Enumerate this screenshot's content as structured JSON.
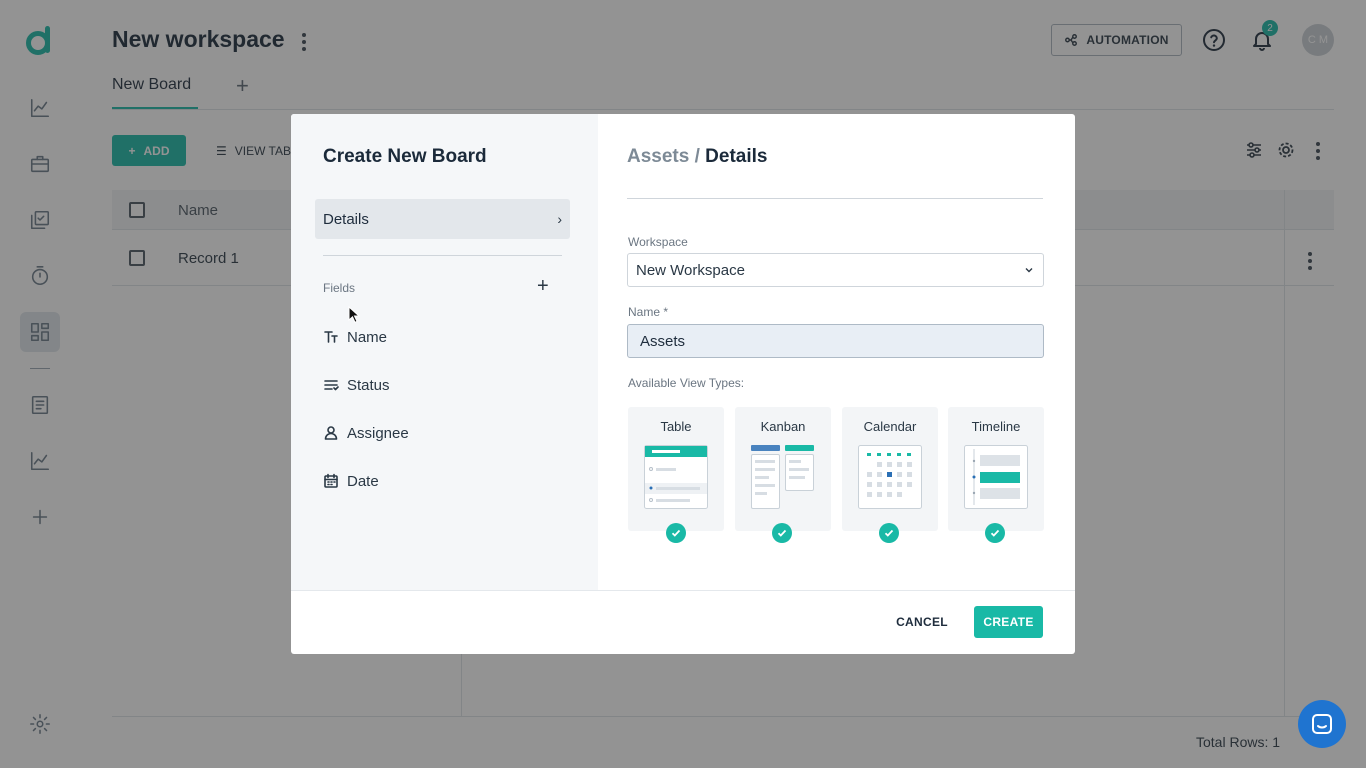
{
  "header": {
    "workspace_title": "New workspace",
    "automation_label": "AUTOMATION",
    "notification_count": "2",
    "avatar_initials": "C M"
  },
  "tabs": [
    {
      "label": "New Board",
      "active": true
    }
  ],
  "toolbar": {
    "add_label": "ADD",
    "view_label": "VIEW TAB"
  },
  "grid": {
    "columns": [
      "Name"
    ],
    "rows": [
      {
        "name": "Record 1"
      }
    ],
    "total_rows": "Total Rows: 1"
  },
  "sidebar": {
    "icons": [
      "analytics-icon",
      "briefcase-icon",
      "tasks-icon",
      "timer-icon",
      "boards-icon",
      "document-icon",
      "reports-icon",
      "add-icon",
      "settings-icon"
    ]
  },
  "modal": {
    "title": "Create New Board",
    "nav_details": "Details",
    "fields_label": "Fields",
    "fields": [
      {
        "label": "Name",
        "icon": "text-type-icon"
      },
      {
        "label": "Status",
        "icon": "status-list-icon"
      },
      {
        "label": "Assignee",
        "icon": "person-icon"
      },
      {
        "label": "Date",
        "icon": "calendar-icon"
      }
    ],
    "breadcrumb_parent": "Assets",
    "breadcrumb_sep": " / ",
    "breadcrumb_current": "Details",
    "workspace_label": "Workspace",
    "workspace_value": "New Workspace",
    "name_label": "Name *",
    "name_value": "Assets",
    "view_types_label": "Available View Types:",
    "view_types": [
      {
        "label": "Table",
        "selected": true
      },
      {
        "label": "Kanban",
        "selected": true
      },
      {
        "label": "Calendar",
        "selected": true
      },
      {
        "label": "Timeline",
        "selected": true
      }
    ],
    "cancel_label": "CANCEL",
    "create_label": "CREATE"
  },
  "colors": {
    "accent": "#19b9a6",
    "title": "#1b2a3a",
    "chat": "#1f74d0"
  }
}
